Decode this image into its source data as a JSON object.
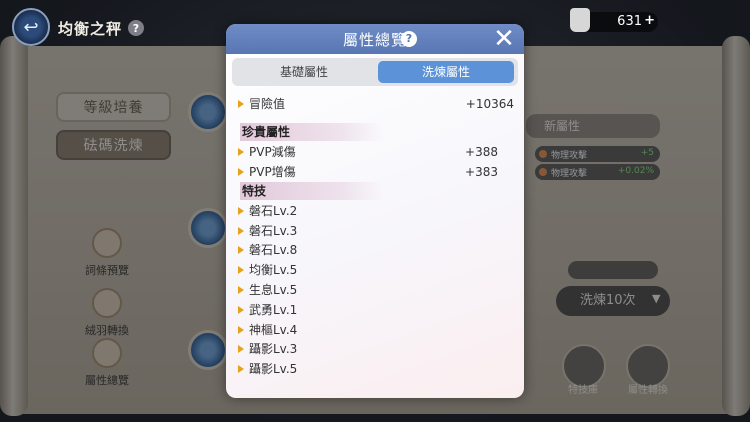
{
  "header": {
    "title": "均衡之秤",
    "help_glyph": "?",
    "currency_value": "631",
    "currency_plus": "+"
  },
  "left_panel": {
    "buttons": [
      {
        "label": "等級培養"
      },
      {
        "label": "砝碼洗煉"
      }
    ],
    "menu": [
      {
        "label": "詞條預覽"
      },
      {
        "label": "絨羽轉換"
      },
      {
        "label": "屬性總覽"
      }
    ]
  },
  "right_panel": {
    "new_attr_title": "新屬性",
    "attributes": [
      {
        "name": "物理攻擊",
        "value": "+5"
      },
      {
        "name": "物理攻擊",
        "value": "+0.02%"
      }
    ],
    "wash_button": "洗煉10次",
    "dropdown_glyph": "▼",
    "round_buttons": [
      {
        "label": "特技庫"
      },
      {
        "label": "屬性轉換"
      }
    ]
  },
  "modal": {
    "title": "屬性總覽",
    "help_glyph": "?",
    "close_glyph": "✕",
    "tabs": [
      {
        "label": "基礎屬性"
      },
      {
        "label": "洗煉屬性"
      }
    ],
    "active_tab": "洗煉屬性",
    "summary": {
      "name": "冒險值",
      "value": "+10364"
    },
    "sections": [
      {
        "title": "珍貴屬性",
        "rows": [
          {
            "name": "PVP減傷",
            "value": "+388"
          },
          {
            "name": "PVP增傷",
            "value": "+383"
          }
        ]
      },
      {
        "title": "特技",
        "rows": [
          {
            "name": "磐石Lv.2"
          },
          {
            "name": "磐石Lv.3"
          },
          {
            "name": "磐石Lv.8"
          },
          {
            "name": "均衡Lv.5"
          },
          {
            "name": "生息Lv.5"
          },
          {
            "name": "武勇Lv.1"
          },
          {
            "name": "神樞Lv.4"
          },
          {
            "name": "躡影Lv.3"
          },
          {
            "name": "躡影Lv.5"
          }
        ]
      }
    ]
  },
  "colors": {
    "header_blue": "#5b78b4",
    "active_tab": "#5b92d8",
    "bullet": "#e6a21a",
    "section_tint": "#cda0be"
  }
}
